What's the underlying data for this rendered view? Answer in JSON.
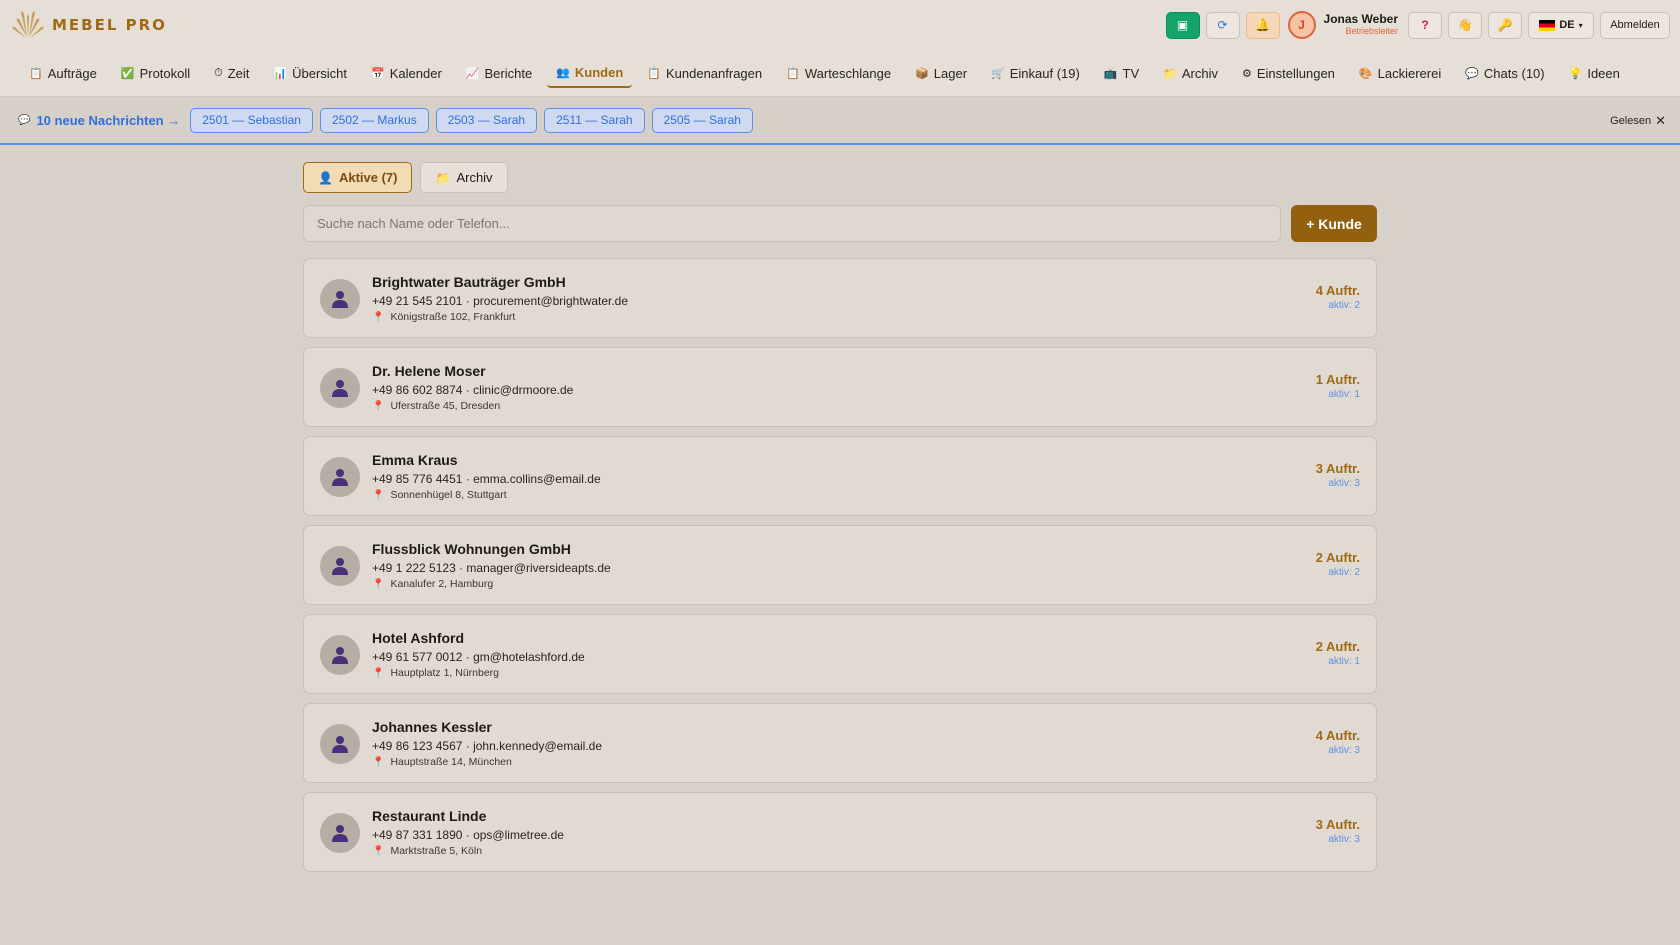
{
  "app": {
    "name": "MEBEL PRO"
  },
  "header": {
    "user_name": "Jonas Weber",
    "user_role": "Betriebsleiter",
    "avatar_initial": "J",
    "language": "DE",
    "logout_label": "Abmelden",
    "icons": [
      "screen-icon",
      "refresh-icon",
      "bell-icon",
      "help-icon",
      "hand-icon",
      "key-icon"
    ]
  },
  "nav": {
    "items": [
      {
        "label": "Aufträge",
        "icon": "📋"
      },
      {
        "label": "Protokoll",
        "icon": "✅"
      },
      {
        "label": "Zeit",
        "icon": "⏱"
      },
      {
        "label": "Übersicht",
        "icon": "📊"
      },
      {
        "label": "Kalender",
        "icon": "📅"
      },
      {
        "label": "Berichte",
        "icon": "📈"
      },
      {
        "label": "Kunden",
        "icon": "👥"
      },
      {
        "label": "Kundenanfragen",
        "icon": "📋"
      },
      {
        "label": "Warteschlange",
        "icon": "📋"
      },
      {
        "label": "Lager",
        "icon": "📦"
      },
      {
        "label": "Einkauf (19)",
        "icon": "🛒"
      },
      {
        "label": "TV",
        "icon": "📺"
      },
      {
        "label": "Archiv",
        "icon": "📁"
      },
      {
        "label": "Einstellungen",
        "icon": "⚙"
      },
      {
        "label": "Lackiererei",
        "icon": "🎨"
      },
      {
        "label": "Chats (10)",
        "icon": "💬"
      },
      {
        "label": "Ideen",
        "icon": "💡"
      }
    ],
    "active_index": 6
  },
  "notifications": {
    "title": "10 neue Nachrichten →",
    "chips": [
      "2501 — Sebastian",
      "2502 — Markus",
      "2503 — Sarah",
      "2511 — Sarah",
      "2505 — Sarah"
    ],
    "read_label": "Gelesen"
  },
  "tabs": {
    "active_label": "Aktive (7)",
    "archive_label": "Archiv"
  },
  "search": {
    "placeholder": "Suche nach Name oder Telefon..."
  },
  "add_customer_label": "+ Kunde",
  "customers": [
    {
      "name": "Brightwater Bauträger GmbH",
      "contact": "+49 21 545 2101 · procurement@brightwater.de",
      "address": "Königstraße 102, Frankfurt",
      "orders": "4 Auftr.",
      "active": "aktiv: 2"
    },
    {
      "name": "Dr. Helene Moser",
      "contact": "+49 86 602 8874 · clinic@drmoore.de",
      "address": "Uferstraße 45, Dresden",
      "orders": "1 Auftr.",
      "active": "aktiv: 1"
    },
    {
      "name": "Emma Kraus",
      "contact": "+49 85 776 4451 · emma.collins@email.de",
      "address": "Sonnenhügel 8, Stuttgart",
      "orders": "3 Auftr.",
      "active": "aktiv: 3"
    },
    {
      "name": "Flussblick Wohnungen GmbH",
      "contact": "+49 1 222 5123 · manager@riversideapts.de",
      "address": "Kanalufer 2, Hamburg",
      "orders": "2 Auftr.",
      "active": "aktiv: 2"
    },
    {
      "name": "Hotel Ashford",
      "contact": "+49 61 577 0012 · gm@hotelashford.de",
      "address": "Hauptplatz 1, Nürnberg",
      "orders": "2 Auftr.",
      "active": "aktiv: 1"
    },
    {
      "name": "Johannes Kessler",
      "contact": "+49 86 123 4567 · john.kennedy@email.de",
      "address": "Hauptstraße 14, München",
      "orders": "4 Auftr.",
      "active": "aktiv: 3"
    },
    {
      "name": "Restaurant Linde",
      "contact": "+49 87 331 1890 · ops@limetree.de",
      "address": "Marktstraße 5, Köln",
      "orders": "3 Auftr.",
      "active": "aktiv: 3"
    }
  ],
  "colors": {
    "accent": "#a06a15",
    "link": "#2f6fe0",
    "avatar_figure": "#4a2f7a"
  }
}
